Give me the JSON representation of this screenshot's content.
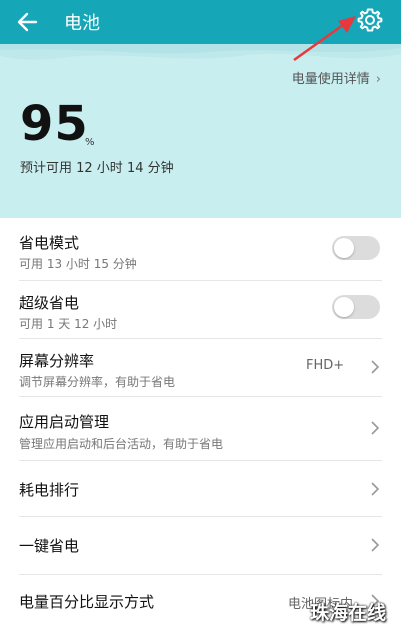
{
  "header": {
    "title": "电池",
    "back_icon": "back-arrow-icon",
    "settings_icon": "gear-icon",
    "bg_color": "#15a6b8"
  },
  "hero": {
    "usage_details_label": "电量使用详情",
    "battery_percent": "95",
    "percent_sign": "%",
    "estimate": "预计可用 12 小时 14 分钟",
    "bg_color": "#c9eef0"
  },
  "items": [
    {
      "label": "省电模式",
      "sub": "可用 13 小时 15 分钟",
      "control": "toggle",
      "on": false
    },
    {
      "label": "超级省电",
      "sub": "可用 1 天 12 小时",
      "control": "toggle",
      "on": false
    },
    {
      "label": "屏幕分辨率",
      "sub": "调节屏幕分辨率，有助于省电",
      "value": "FHD+",
      "control": "chevron"
    },
    {
      "label": "应用启动管理",
      "sub": "管理应用启动和后台活动，有助于省电",
      "control": "chevron"
    },
    {
      "label": "耗电排行",
      "control": "chevron"
    },
    {
      "label": "一键省电",
      "control": "chevron"
    },
    {
      "label": "电量百分比显示方式",
      "value": "电池图标内",
      "control": "chevron"
    }
  ],
  "annotation": {
    "arrow_color": "#e8383d"
  },
  "watermark": {
    "text": "珠海在线"
  }
}
